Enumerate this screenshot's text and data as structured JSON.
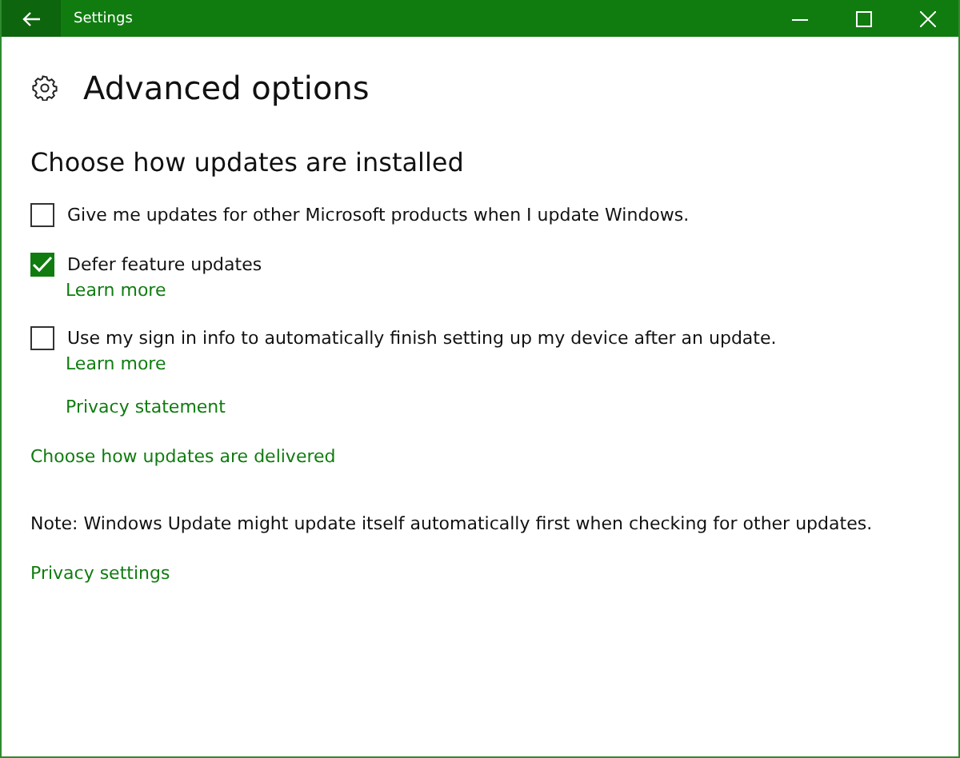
{
  "window": {
    "title": "Settings"
  },
  "page": {
    "title": "Advanced options"
  },
  "section": {
    "title": "Choose how updates are installed"
  },
  "options": [
    {
      "label": "Give me updates for other Microsoft products when I update Windows.",
      "checked": false
    },
    {
      "label": "Defer feature updates",
      "checked": true,
      "links": [
        "Learn more"
      ]
    },
    {
      "label": "Use my sign in info to automatically finish setting up my device after an update.",
      "checked": false,
      "links": [
        "Learn more"
      ]
    }
  ],
  "privacy_statement": "Privacy statement",
  "delivery_link": "Choose how updates are delivered",
  "note": "Note: Windows Update might update itself automatically first when checking for other updates.",
  "privacy_settings": "Privacy settings"
}
